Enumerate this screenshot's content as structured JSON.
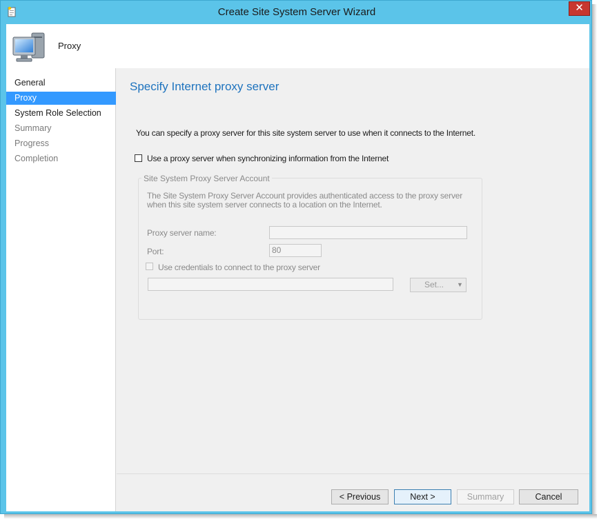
{
  "window": {
    "title": "Create Site System Server Wizard",
    "close_label": "✕"
  },
  "header": {
    "title": "Proxy"
  },
  "nav": {
    "items": [
      {
        "label": "General"
      },
      {
        "label": "Proxy"
      },
      {
        "label": "System Role Selection"
      },
      {
        "label": "Summary"
      },
      {
        "label": "Progress"
      },
      {
        "label": "Completion"
      }
    ]
  },
  "main": {
    "title": "Specify Internet proxy server",
    "description": "You can specify a proxy server for this site system server to use when it connects to the Internet.",
    "use_proxy_label": "Use a proxy server when synchronizing information from the Internet",
    "use_proxy_checked": false,
    "account_group": {
      "label": "Site System Proxy Server Account",
      "description": "The Site System Proxy Server Account provides authenticated access to the proxy server when this site system server connects to a location on the Internet.",
      "proxy_name_label": "Proxy server name:",
      "proxy_name_value": "",
      "port_label": "Port:",
      "port_value": "80",
      "use_credentials_label": "Use credentials to connect to the proxy server",
      "account_value": "",
      "set_button_label": "Set...",
      "set_dropdown_icon": "▼"
    }
  },
  "footer": {
    "previous_label": "< Previous",
    "next_label": "Next >",
    "summary_label": "Summary",
    "cancel_label": "Cancel"
  },
  "icons": {
    "title": "wizard-document-icon",
    "header": "computer-monitor-icon"
  },
  "colors": {
    "title_bar": "#5bc4e9",
    "accent": "#1e73be",
    "selected": "#3399ff",
    "close": "#c7372f"
  }
}
